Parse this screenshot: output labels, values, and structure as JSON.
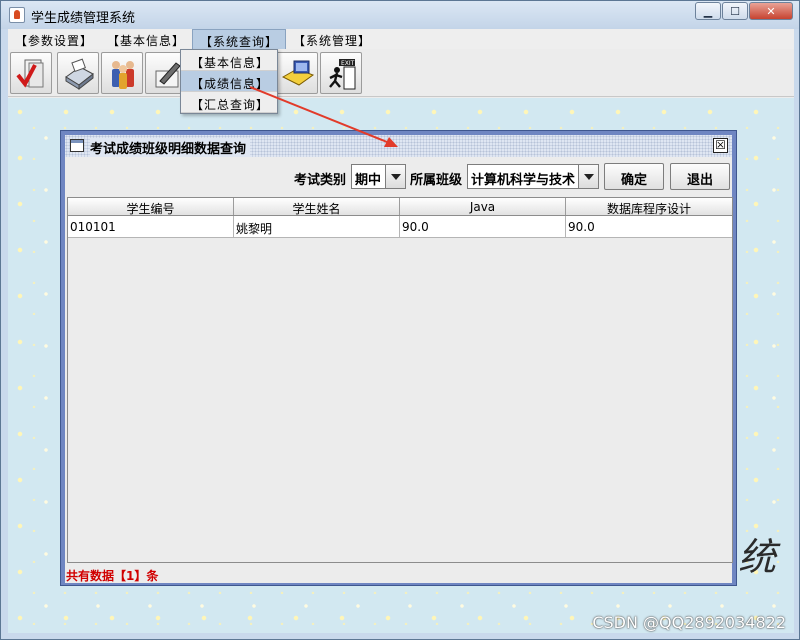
{
  "window": {
    "title": "学生成绩管理系统",
    "min": "▁",
    "max": "☐",
    "close": "✕"
  },
  "menubar": [
    "【参数设置】",
    "【基本信息】",
    "【系统查询】",
    "【系统管理】"
  ],
  "dropdown": [
    "【基本信息】",
    "【成绩信息】",
    "【汇总查询】"
  ],
  "toolbar": {
    "icons": [
      "check-document-icon",
      "fax-machine-icon",
      "people-icon",
      "edit-icon",
      "folder-computer-icon",
      "exit-icon"
    ],
    "exit_text": "EXIT"
  },
  "background_text": "统",
  "dialog": {
    "title": "考试成绩班级明细数据查询",
    "close": "☒",
    "exam_type_label": "考试类别",
    "exam_type_value": "期中",
    "class_label": "所属班级",
    "class_value": "计算机科学与技术",
    "confirm": "确定",
    "exit": "退出",
    "table": {
      "columns": [
        "学生编号",
        "学生姓名",
        "Java",
        "数据库程序设计"
      ],
      "rows": [
        [
          "010101",
          "姚黎明",
          "90.0",
          "90.0"
        ]
      ]
    },
    "status": "共有数据【1】条"
  },
  "watermark": "CSDN @QQ2892034822",
  "colors": {
    "status": "#d10000",
    "dialog_border": "#6f86c2",
    "arrow": "#e23b2a"
  }
}
